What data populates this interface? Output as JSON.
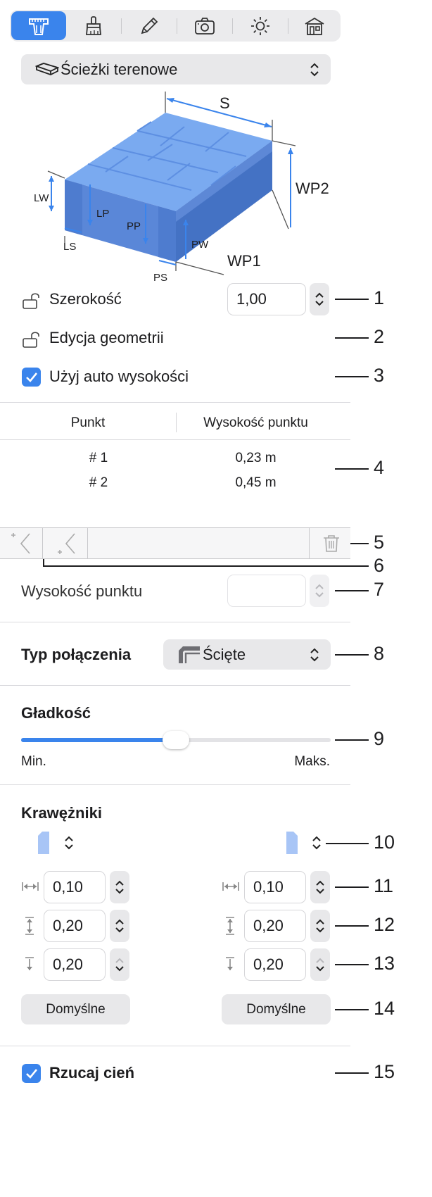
{
  "toolbar": {
    "tabs": [
      {
        "icon": "path-ruler-icon",
        "active": true
      },
      {
        "icon": "brush-icon",
        "active": false
      },
      {
        "icon": "pencil-icon",
        "active": false
      },
      {
        "icon": "camera-icon",
        "active": false
      },
      {
        "icon": "sun-icon",
        "active": false
      },
      {
        "icon": "house-icon",
        "active": false
      }
    ]
  },
  "type_select": {
    "value": "Ścieżki terenowe",
    "icon": "terrain-path-icon"
  },
  "diagram": {
    "labels": {
      "s": "S",
      "wp2": "WP2",
      "wp1": "WP1",
      "lw": "LW",
      "lp": "LP",
      "pp": "PP",
      "pw": "PW",
      "ls": "LS",
      "ps": "PS"
    }
  },
  "width_row": {
    "label": "Szerokość",
    "value": "1,00"
  },
  "geometry_row": {
    "label": "Edycja geometrii"
  },
  "auto_height": {
    "label": "Użyj auto wysokości",
    "checked": true
  },
  "points_table": {
    "headers": [
      "Punkt",
      "Wysokość punktu"
    ],
    "rows": [
      {
        "point": "# 1",
        "height": "0,23 m"
      },
      {
        "point": "# 2",
        "height": "0,45 m"
      }
    ]
  },
  "point_height": {
    "label": "Wysokość punktu",
    "value": ""
  },
  "join_type": {
    "label": "Typ połączenia",
    "value": "Ścięte"
  },
  "smoothness": {
    "label": "Gładkość",
    "min_label": "Min.",
    "max_label": "Maks.",
    "value": 0.5
  },
  "curbs": {
    "label": "Krawężniki",
    "left": {
      "width": "0,10",
      "height": "0,20",
      "depth": "0,20",
      "default_label": "Domyślne"
    },
    "right": {
      "width": "0,10",
      "height": "0,20",
      "depth": "0,20",
      "default_label": "Domyślne"
    }
  },
  "cast_shadow": {
    "label": "Rzucaj cień",
    "checked": true
  },
  "callouts": [
    "1",
    "2",
    "3",
    "4",
    "5",
    "6",
    "7",
    "8",
    "9",
    "10",
    "11",
    "12",
    "13",
    "14",
    "15"
  ],
  "colors": {
    "accent": "#3a84ec",
    "block_dark": "#4f7fd0",
    "block_light": "#8fbaf3"
  }
}
